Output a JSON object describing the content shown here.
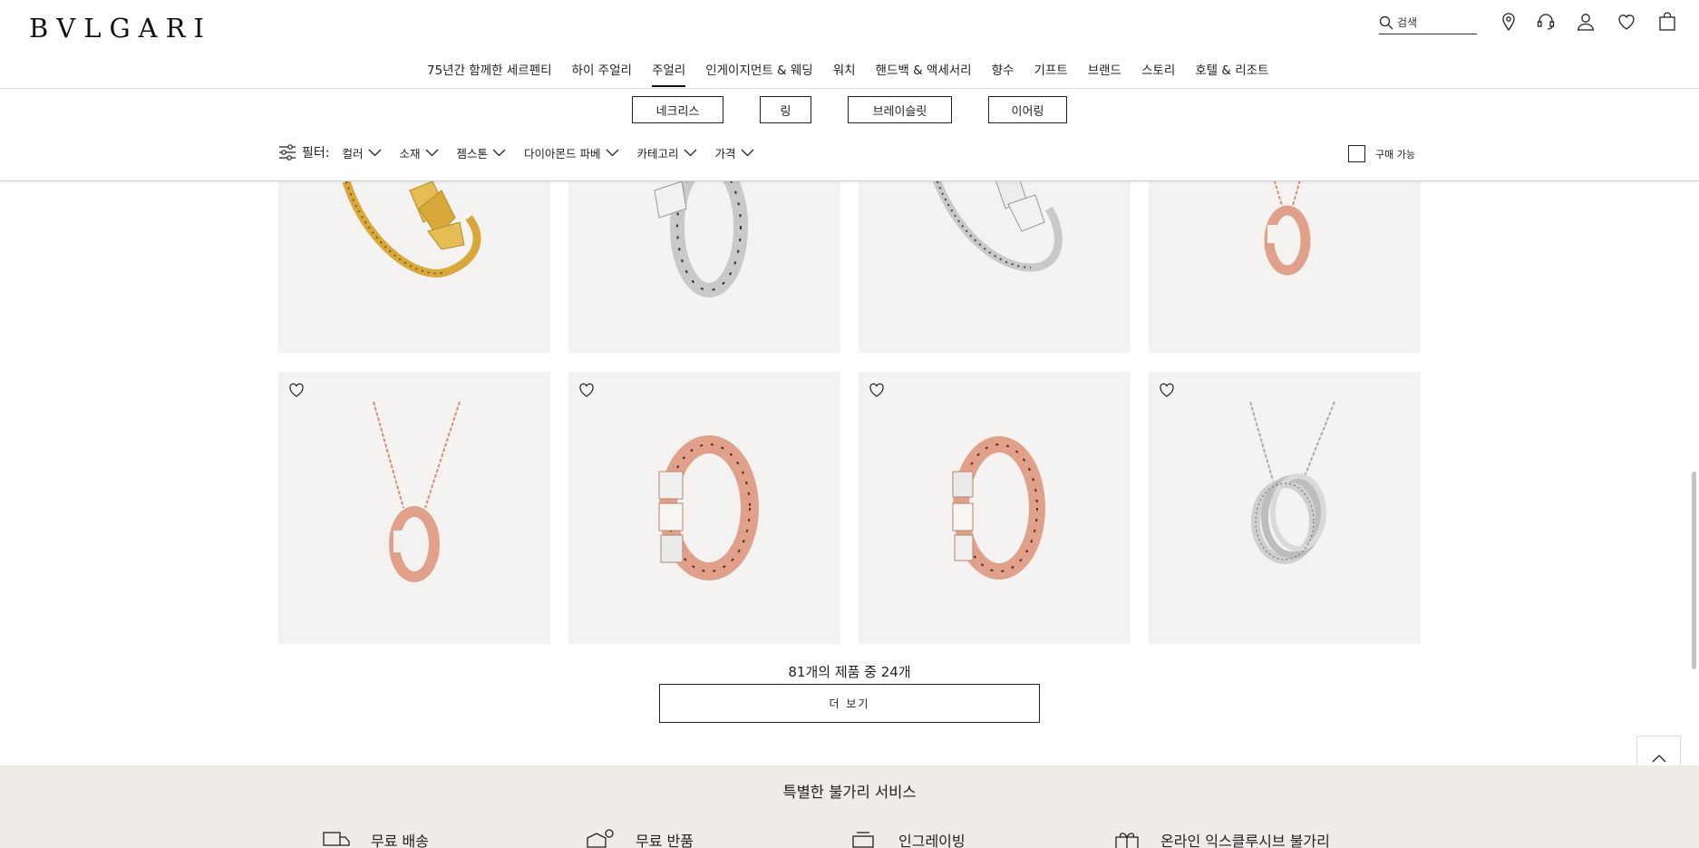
{
  "header": {
    "logo": "BVLGARI",
    "search_placeholder": "검색"
  },
  "nav": {
    "items": [
      "75년간 함께한 세르펜티",
      "하이 주얼리",
      "주얼리",
      "인게이지먼트 & 웨딩",
      "워치",
      "핸드백 & 액세서리",
      "향수",
      "기프트",
      "브랜드",
      "스토리",
      "호텔 & 리조트"
    ],
    "active": "주얼리"
  },
  "categories": [
    "네크리스",
    "링",
    "브레이슬릿",
    "이어링"
  ],
  "filters": {
    "label": "필터:",
    "items": [
      "컬러",
      "소재",
      "젬스톤",
      "다이아몬드 파베",
      "카테고리",
      "가격"
    ],
    "purchasable_label": "구매 가능"
  },
  "products": {
    "row1": [
      "gold-serpenti-bracelet",
      "white-gold-serpenti-ring",
      "white-gold-serpenti-bracelet",
      "rose-gold-serpenti-necklace"
    ],
    "row2": [
      "rose-gold-serpenti-pendant-necklace",
      "rose-gold-serpenti-pave-ring",
      "rose-gold-serpenti-ring",
      "white-gold-serpenti-pave-pendant"
    ]
  },
  "pagination": {
    "count_text": "81개의 제품 중 24개",
    "more_label": "더 보기"
  },
  "services": {
    "title": "특별한 불가리 서비스",
    "items": [
      "무료 배송",
      "무료 반품",
      "인그레이빙",
      "온라인 익스클루시브 불가리"
    ]
  },
  "colors": {
    "card_bg": "#f4f3f2",
    "services_bg": "#efebe6",
    "gold": "#d9a83a",
    "rose_gold": "#e0a08a",
    "silver": "#c9c9c9"
  }
}
